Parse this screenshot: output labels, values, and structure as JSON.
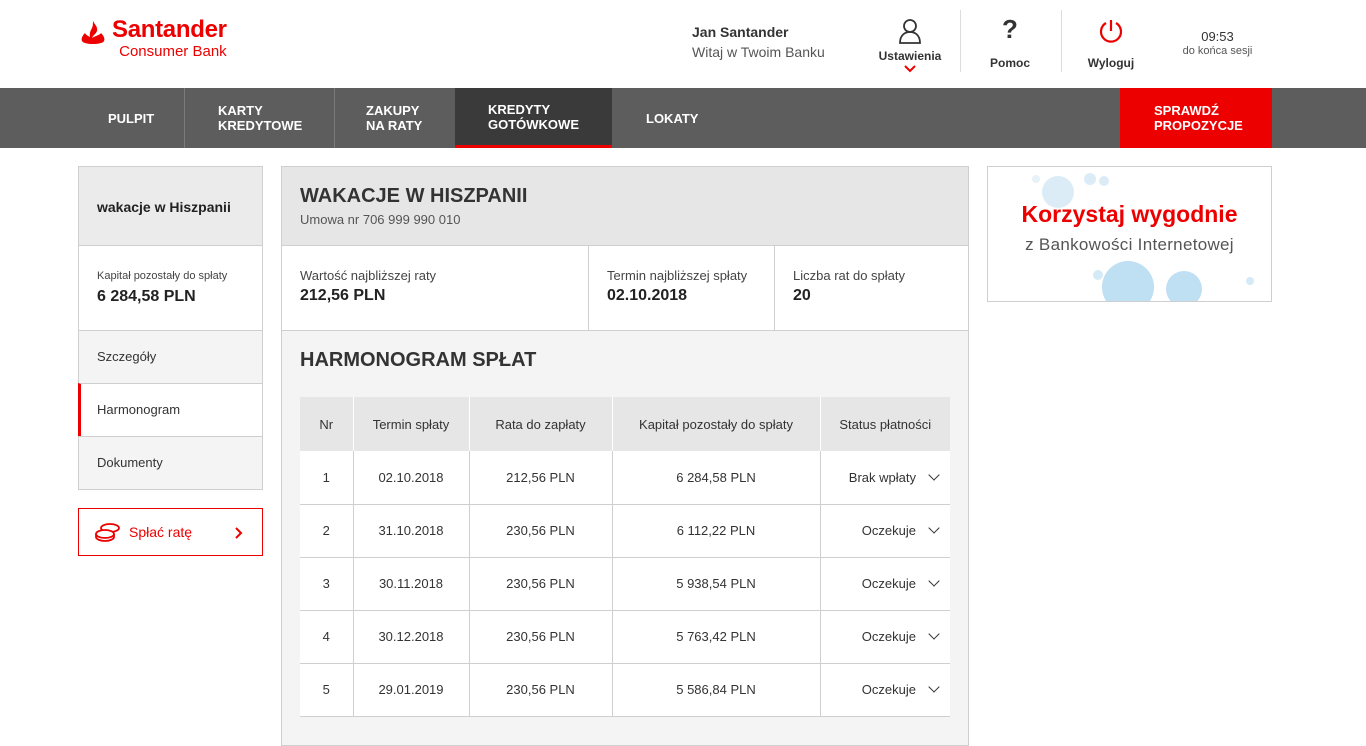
{
  "brand": {
    "name": "Santander",
    "sub": "Consumer Bank",
    "color": "#ec0000"
  },
  "user": {
    "name": "Jan Santander",
    "greeting": "Witaj w Twoim Banku"
  },
  "header_actions": {
    "settings": "Ustawienia",
    "help": "Pomoc",
    "logout": "Wyloguj"
  },
  "session": {
    "time": "09:53",
    "label": "do końca sesji"
  },
  "nav": {
    "items": [
      {
        "line1": "PULPIT",
        "line2": ""
      },
      {
        "line1": "KARTY",
        "line2": "KREDYTOWE"
      },
      {
        "line1": "ZAKUPY",
        "line2": "NA RATY"
      },
      {
        "line1": "KREDYTY",
        "line2": "GOTÓWKOWE"
      },
      {
        "line1": "LOKATY",
        "line2": ""
      }
    ],
    "active_index": 3,
    "cta": {
      "line1": "SPRAWDŹ",
      "line2": "PROPOZYCJE"
    }
  },
  "sidebar": {
    "title": "wakacje w Hiszpanii",
    "capital_label": "Kapitał pozostały do spłaty",
    "capital_value": "6 284,58 PLN",
    "links": [
      "Szczegóły",
      "Harmonogram",
      "Dokumenty"
    ],
    "active_link": 1,
    "pay_button": "Spłać ratę"
  },
  "main": {
    "title": "WAKACJE W HISZPANII",
    "contract": "Umowa nr 706 999 990 010",
    "stats": [
      {
        "label": "Wartość najbliższej raty",
        "value": "212,56 PLN"
      },
      {
        "label": "Termin najbliższej spłaty",
        "value": "02.10.2018"
      },
      {
        "label": "Liczba rat do spłaty",
        "value": "20"
      }
    ],
    "schedule_title": "HARMONOGRAM SPŁAT",
    "table": {
      "headers": [
        "Nr",
        "Termin spłaty",
        "Rata do zapłaty",
        "Kapitał pozostały do spłaty",
        "Status płatności"
      ],
      "rows": [
        [
          "1",
          "02.10.2018",
          "212,56 PLN",
          "6 284,58 PLN",
          "Brak wpłaty"
        ],
        [
          "2",
          "31.10.2018",
          "230,56 PLN",
          "6 112,22 PLN",
          "Oczekuje"
        ],
        [
          "3",
          "30.11.2018",
          "230,56 PLN",
          "5 938,54 PLN",
          "Oczekuje"
        ],
        [
          "4",
          "30.12.2018",
          "230,56 PLN",
          "5 763,42 PLN",
          "Oczekuje"
        ],
        [
          "5",
          "29.01.2019",
          "230,56 PLN",
          "5 586,84 PLN",
          "Oczekuje"
        ]
      ]
    }
  },
  "ad": {
    "headline": "Korzystaj wygodnie",
    "sub": "z Bankowości Internetowej"
  },
  "icons": {
    "settings": "user-icon",
    "help": "question-icon",
    "logout": "power-icon",
    "pay": "coins-icon"
  }
}
